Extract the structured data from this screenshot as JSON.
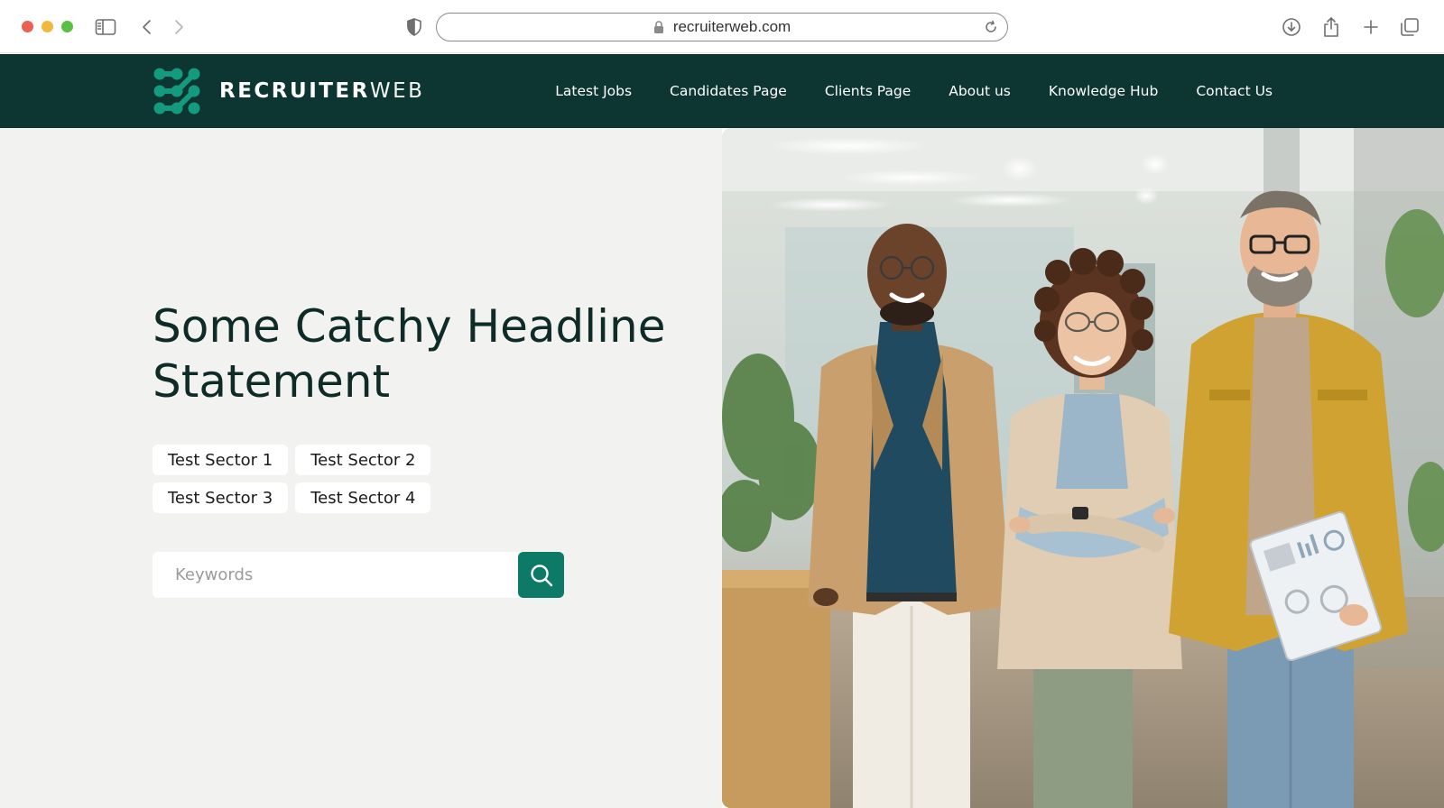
{
  "browser": {
    "url": "recruiterweb.com",
    "icons": [
      "sidebar-icon",
      "back-icon",
      "forward-icon",
      "privacy-shield-icon",
      "lock-icon",
      "reload-icon",
      "download-icon",
      "share-icon",
      "new-tab-icon",
      "tabs-overview-icon"
    ]
  },
  "header": {
    "logo": {
      "bold": "RECRUITER",
      "light": "WEB"
    },
    "nav": [
      {
        "label": "Latest Jobs"
      },
      {
        "label": "Candidates Page"
      },
      {
        "label": "Clients Page"
      },
      {
        "label": "About us"
      },
      {
        "label": "Knowledge Hub"
      },
      {
        "label": "Contact Us"
      }
    ]
  },
  "hero": {
    "headline": "Some Catchy Headline Statement",
    "sectors": [
      {
        "label": "Test Sector 1"
      },
      {
        "label": "Test Sector 2"
      },
      {
        "label": "Test Sector 3"
      },
      {
        "label": "Test Sector 4"
      }
    ],
    "search": {
      "placeholder": "Keywords",
      "value": ""
    },
    "image_alt": "Three smiling colleagues standing in a bright office"
  },
  "colors": {
    "header_bg": "#0d3531",
    "accent": "#0d7a67",
    "hero_bg": "#f2f3f0",
    "headline": "#0f2b27"
  }
}
